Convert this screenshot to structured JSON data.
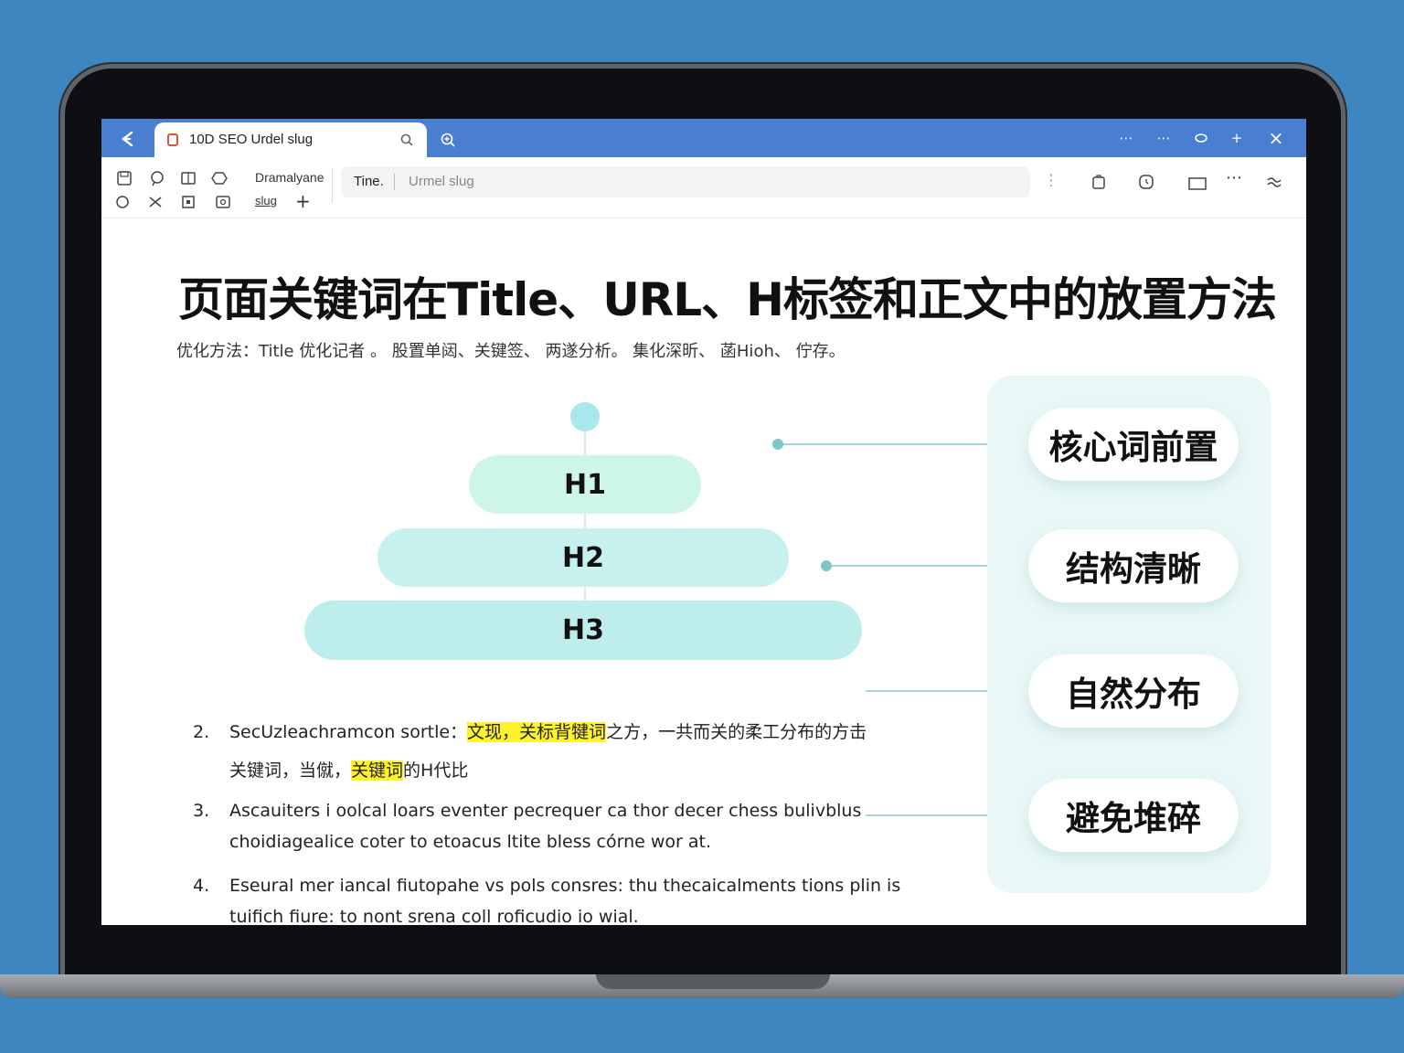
{
  "browser": {
    "tab_title": "10D SEO Urdel slug",
    "toolbar_label_1": "Dramalyane",
    "toolbar_label_2": "slug",
    "address_title": "Tine.",
    "address_url": "Urmel slug"
  },
  "article": {
    "title": "页面关键词在Title、URL、H标签和正文中的放置方法",
    "subtitle": "优化方法：Title 优化记者 。 股置单闼、关键签、 两遂分析。 集化深昕、 菡Hioh、 佇存。"
  },
  "diagram": {
    "levels": [
      "H1",
      "H2",
      "H3"
    ],
    "callouts": [
      "核心词前置",
      "结构清晰",
      "自然分布",
      "避免堆碎"
    ]
  },
  "list": {
    "items": [
      {
        "number": "2.",
        "line1_before": "SecUzleachramcon sortle：",
        "line1_highlight": "文现，关标背犍词",
        "line1_after": "之方，一共而关的柔工分布的方击",
        "line2_before": "关键词，当僦，",
        "line2_highlight": "关键词",
        "line2_after": "的H代比"
      },
      {
        "number": "3.",
        "line1": "Ascauiters i oolcal loars eventer pecrequer ca thor decer chess bulivblus",
        "line2": "choidiagealice coter to etoacus ltite bless córne wor at."
      },
      {
        "number": "4.",
        "line1": "Eseural mer iancal fiutopahe vs pols consres: thu thecaicalments tions plin is",
        "line2": "tuifich fiure: to nont srena coll roficudio io wial."
      }
    ]
  },
  "colors": {
    "background": "#3d86bf",
    "titlebar": "#4a7ed0",
    "highlight": "#fff22a",
    "pill_h1": "#cdf6e6",
    "pill_h2": "#c6f1ee",
    "pill_h3": "#bdeeec",
    "connector": "#9fd6d8"
  }
}
